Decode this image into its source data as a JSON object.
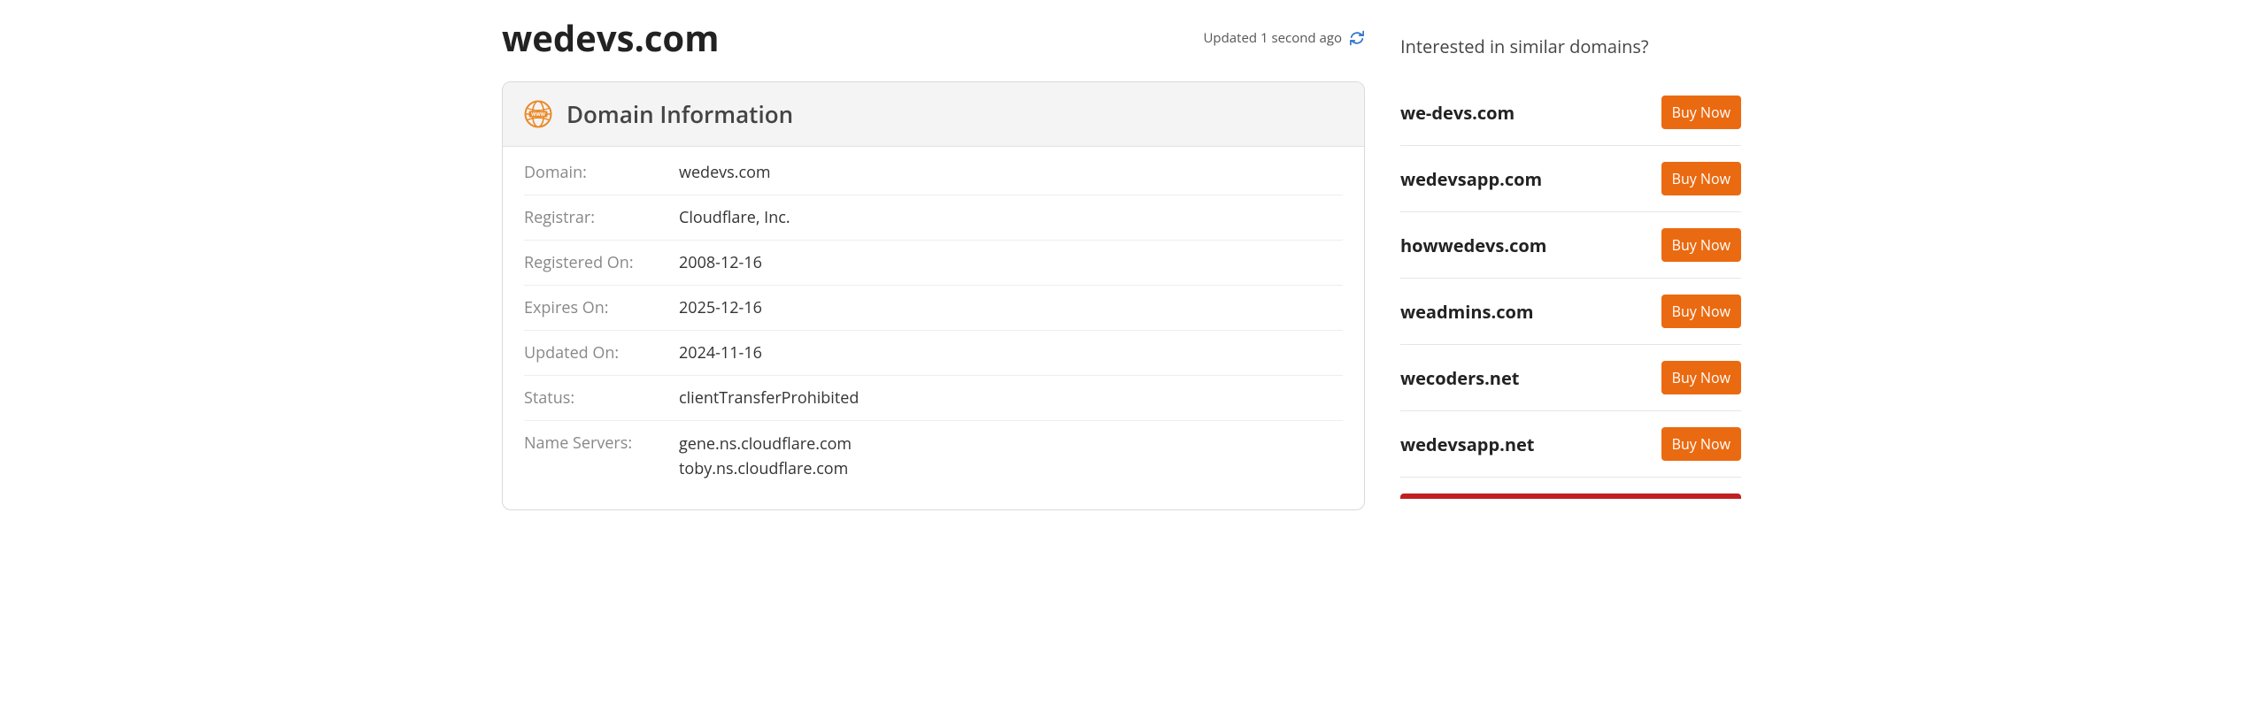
{
  "header": {
    "title": "wedevs.com",
    "updated_text": "Updated 1 second ago"
  },
  "domain_info": {
    "card_title": "Domain Information",
    "rows": {
      "domain": {
        "label": "Domain:",
        "value": "wedevs.com"
      },
      "registrar": {
        "label": "Registrar:",
        "value": "Cloudflare, Inc."
      },
      "registered": {
        "label": "Registered On:",
        "value": "2008-12-16"
      },
      "expires": {
        "label": "Expires On:",
        "value": "2025-12-16"
      },
      "updated": {
        "label": "Updated On:",
        "value": "2024-11-16"
      },
      "status": {
        "label": "Status:",
        "value": "clientTransferProhibited"
      },
      "nameservers": {
        "label": "Name Servers:",
        "value0": "gene.ns.cloudflare.com",
        "value1": "toby.ns.cloudflare.com"
      }
    }
  },
  "sidebar": {
    "title": "Interested in similar domains?",
    "buy_label": "Buy Now",
    "items": [
      {
        "domain": "we-devs.com"
      },
      {
        "domain": "wedevsapp.com"
      },
      {
        "domain": "howwedevs.com"
      },
      {
        "domain": "weadmins.com"
      },
      {
        "domain": "wecoders.net"
      },
      {
        "domain": "wedevsapp.net"
      }
    ]
  }
}
